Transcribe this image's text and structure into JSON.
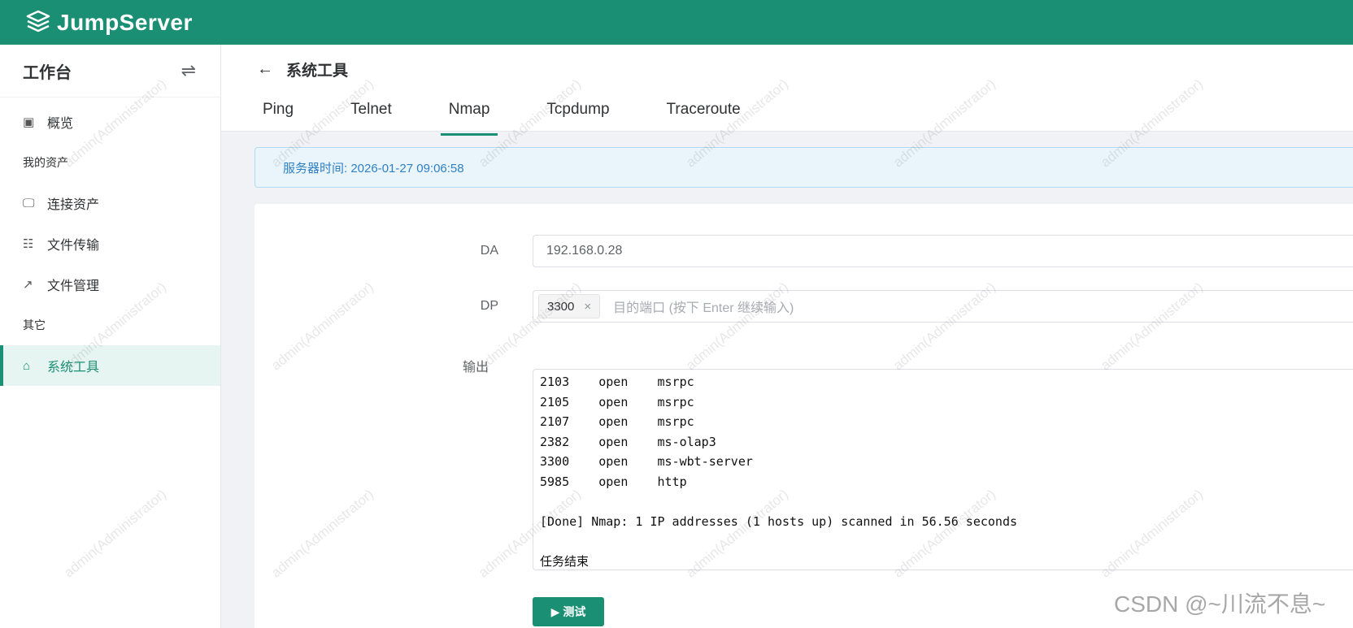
{
  "brand": {
    "name": "JumpServer",
    "bar_color": "#1a8f74"
  },
  "sidebar": {
    "title": "工作台",
    "switch_icon": "⇌",
    "items": [
      {
        "label": "概览",
        "icon": "monitor-icon",
        "glyph": "▣"
      },
      {
        "group": "我的资产"
      },
      {
        "label": "连接资产",
        "icon": "desktop-icon",
        "glyph": "🖵"
      },
      {
        "label": "文件传输",
        "icon": "file-icon",
        "glyph": "☷"
      },
      {
        "label": "文件管理",
        "icon": "external-link-icon",
        "glyph": "↗"
      },
      {
        "group": "其它"
      },
      {
        "label": "系统工具",
        "icon": "toolbox-icon",
        "glyph": "⌂",
        "active": true
      }
    ]
  },
  "header": {
    "back_icon": "←",
    "title": "系统工具",
    "tabs": [
      "Ping",
      "Telnet",
      "Nmap",
      "Tcpdump",
      "Traceroute"
    ],
    "active_tab": "Nmap"
  },
  "alert": {
    "text": "服务器时间: 2026-01-27 09:06:58"
  },
  "form": {
    "da_label": "DA",
    "da_value": "192.168.0.28",
    "dp_label": "DP",
    "dp_tag": "3300",
    "dp_tag_close": "×",
    "dp_placeholder": "目的端口 (按下 Enter 继续输入)",
    "output_label": "输出",
    "output_text": "2103    open    msrpc\n2105    open    msrpc\n2107    open    msrpc\n2382    open    ms-olap3\n3300    open    ms-wbt-server\n5985    open    http\n\n[Done] Nmap: 1 IP addresses (1 hosts up) scanned in 56.56 seconds\n\n任务结束",
    "test_button": "▶ 测试"
  },
  "watermark": "admin(Administrator)",
  "overlay": {
    "csdn": "CSDN @~川流不息~"
  }
}
